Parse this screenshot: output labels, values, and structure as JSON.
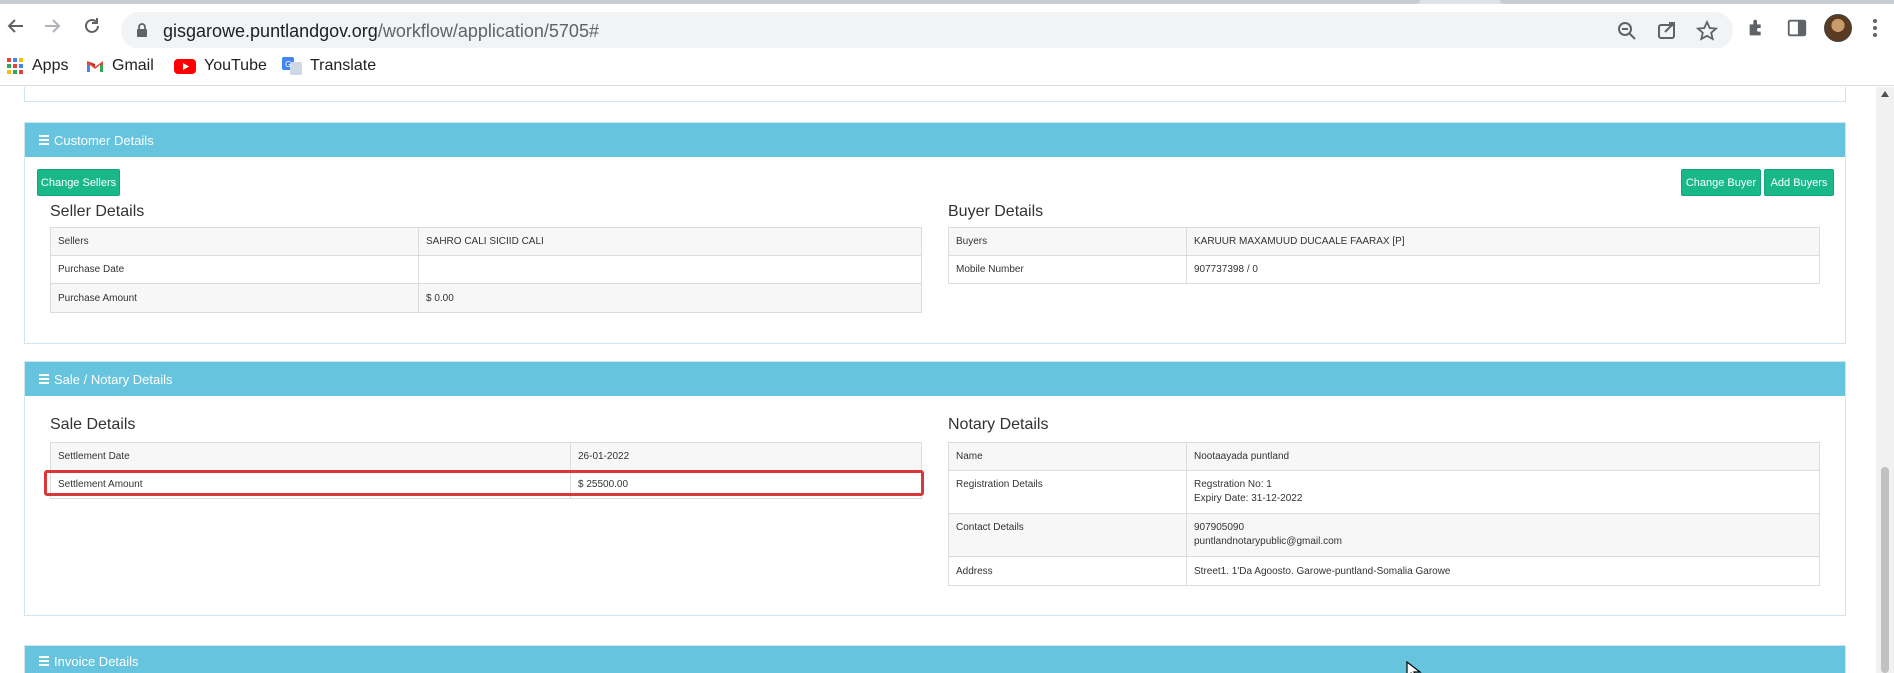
{
  "browser": {
    "url_host": "gisgarowe.puntlandgov.org",
    "url_path": "/workflow/application/5705#",
    "bookmarks": [
      {
        "label": "Apps",
        "icon": "apps-grid-icon"
      },
      {
        "label": "Gmail",
        "icon": "gmail-icon"
      },
      {
        "label": "YouTube",
        "icon": "youtube-icon"
      },
      {
        "label": "Translate",
        "icon": "translate-icon"
      }
    ]
  },
  "customer": {
    "header": "Customer Details",
    "change_sellers": "Change Sellers",
    "change_buyer": "Change Buyer",
    "add_buyers": "Add Buyers",
    "seller_title": "Seller Details",
    "seller_rows": [
      {
        "label": "Sellers",
        "value": "SAHRO CALI SICIID CALI"
      },
      {
        "label": "Purchase Date",
        "value": ""
      },
      {
        "label": "Purchase Amount",
        "value": "$ 0.00"
      }
    ],
    "buyer_title": "Buyer Details",
    "buyer_rows": [
      {
        "label": "Buyers",
        "value": "KARUUR MAXAMUUD DUCAALE FAARAX [P]"
      },
      {
        "label": "Mobile Number",
        "value": "907737398 / 0"
      }
    ]
  },
  "sale": {
    "header": "Sale / Notary Details",
    "sale_title": "Sale Details",
    "sale_rows": [
      {
        "label": "Settlement Date",
        "value": "26-01-2022"
      },
      {
        "label": "Settlement Amount",
        "value": "$ 25500.00"
      }
    ],
    "notary_title": "Notary Details",
    "notary_rows": [
      {
        "label": "Name",
        "value": "Nootaayada puntland",
        "value2": ""
      },
      {
        "label": "Registration Details",
        "value": "Regstration No: 1",
        "value2": "Expiry Date: 31-12-2022"
      },
      {
        "label": "Contact Details",
        "value": "907905090",
        "value2": "puntlandnotarypublic@gmail.com"
      },
      {
        "label": "Address",
        "value": "Street1. 1'Da Agoosto. Garowe-puntland-Somalia Garowe",
        "value2": ""
      }
    ]
  },
  "invoice": {
    "header": "Invoice Details"
  },
  "colors": {
    "panel_header": "#66c4de",
    "button_green": "#18b88a",
    "highlight_red": "#d9383a"
  }
}
